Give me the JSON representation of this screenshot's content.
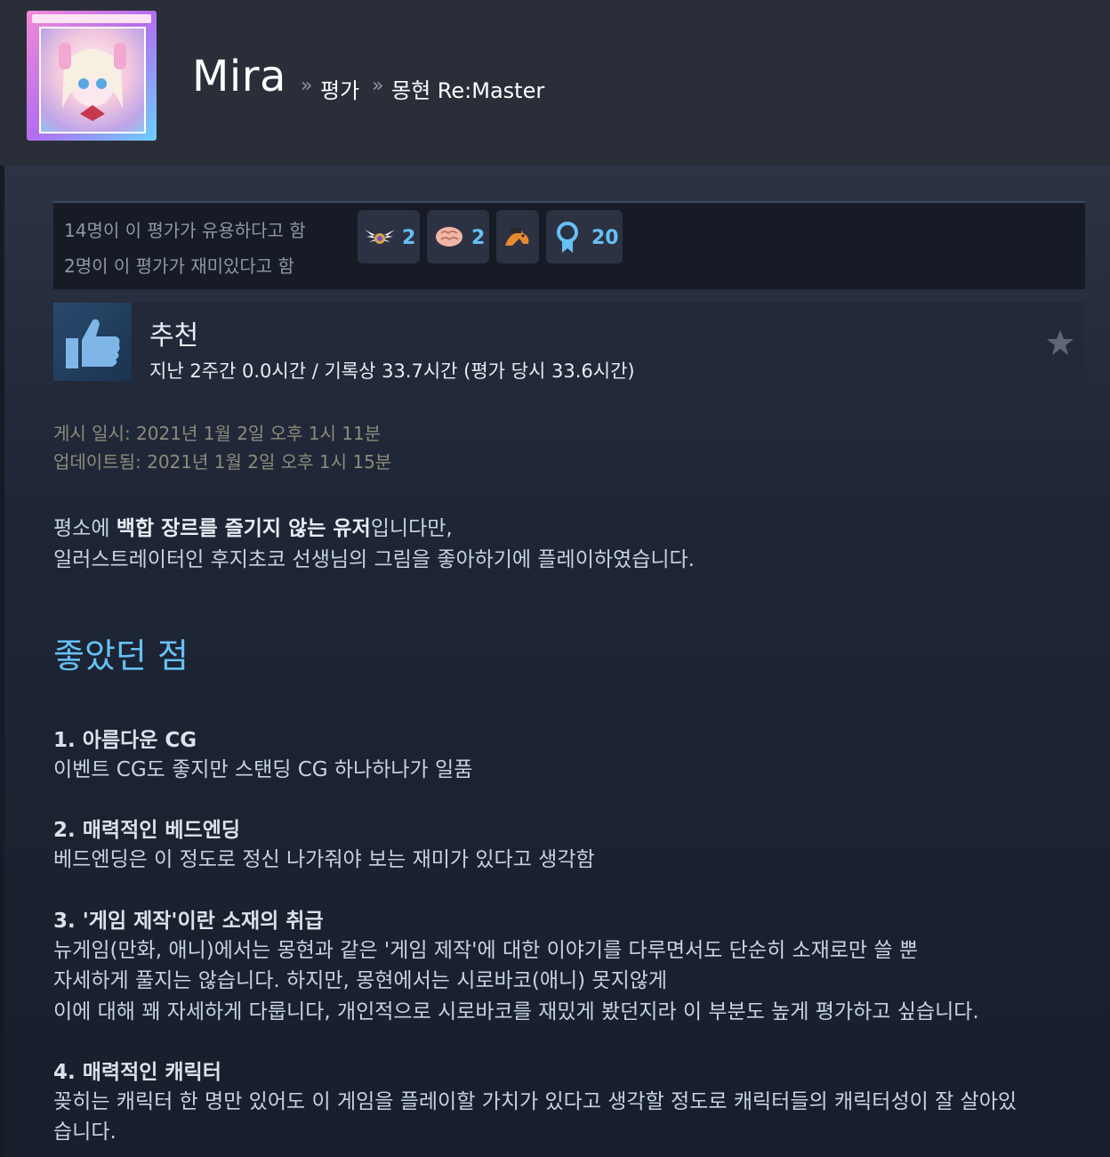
{
  "header": {
    "profile_name": "Mira",
    "breadcrumb": [
      "평가",
      "몽현 Re:Master"
    ],
    "separator": "»"
  },
  "awards": {
    "votes_helpful": "14명이 이 평가가 유용하다고 함",
    "votes_funny": "2명이 이 평가가 재미있다고 함",
    "items": [
      {
        "icon": "winged-medal-icon",
        "count": "2"
      },
      {
        "icon": "brain-icon",
        "count": "2"
      },
      {
        "icon": "horse-head-icon",
        "count": ""
      },
      {
        "icon": "ribbon-award-icon",
        "count": "20"
      }
    ]
  },
  "recommendation": {
    "title": "추천",
    "hours": "지난 2주간 0.0시간 / 기록상 33.7시간 (평가 당시 33.6시간)",
    "thumb_icon": "thumbs-up-icon",
    "star_icon": "star-icon"
  },
  "dates": {
    "posted": "게시 일시: 2021년 1월 2일 오후 1시 11분",
    "updated": "업데이트됨: 2021년 1월 2일 오후 1시 15분"
  },
  "intro": {
    "l1_a": "평소에 ",
    "l1_b": "백합 장르를 즐기지 않는 유저",
    "l1_c": "입니다만,",
    "l2": "일러스트레이터인 후지초코 선생님의 그림을 좋아하기에 플레이하였습니다."
  },
  "section_title": "좋았던 점",
  "items": [
    {
      "title": "1. 아름다운 CG",
      "lines": [
        "이벤트 CG도 좋지만 스탠딩 CG 하나하나가 일품"
      ]
    },
    {
      "title": "2. 매력적인 베드엔딩",
      "lines": [
        "베드엔딩은 이 정도로 정신 나가줘야 보는 재미가 있다고 생각함"
      ]
    },
    {
      "title": "3. '게임 제작'이란 소재의 취급",
      "lines": [
        "뉴게임(만화, 애니)에서는 몽현과 같은 '게임 제작'에 대한 이야기를 다루면서도 단순히 소재로만 쓸 뿐",
        "자세하게 풀지는 않습니다. 하지만, 몽현에서는 시로바코(애니) 못지않게",
        "이에 대해 꽤 자세하게 다룹니다, 개인적으로 시로바코를 재밌게 봤던지라 이 부분도 높게 평가하고 싶습니다."
      ]
    },
    {
      "title": "4. 매력적인 캐릭터",
      "lines": [
        "꽂히는 캐릭터 한 명만 있어도 이 게임을 플레이할 가치가 있다고 생각할 정도로 캐릭터들의 캐릭터성이 잘 살아있",
        "습니다."
      ]
    }
  ]
}
